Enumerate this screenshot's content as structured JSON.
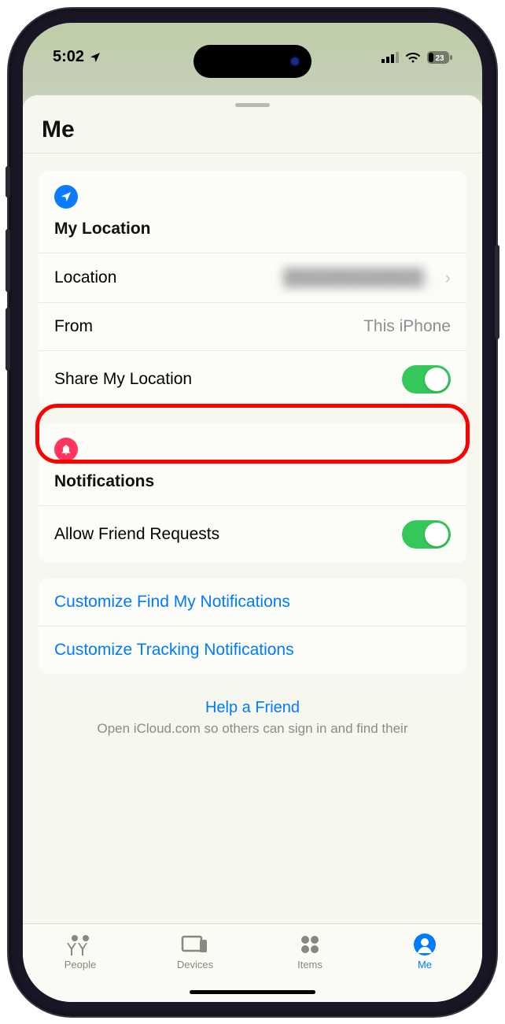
{
  "status": {
    "time": "5:02",
    "battery": "23"
  },
  "sheet": {
    "title": "Me"
  },
  "location": {
    "section_title": "My Location",
    "location_label": "Location",
    "location_value": "████████████…",
    "from_label": "From",
    "from_value": "This iPhone",
    "share_label": "Share My Location"
  },
  "notifications": {
    "section_title": "Notifications",
    "allow_label": "Allow Friend Requests"
  },
  "links": {
    "customize_findmy": "Customize Find My Notifications",
    "customize_tracking": "Customize Tracking Notifications"
  },
  "help": {
    "link": "Help a Friend",
    "sub": "Open iCloud.com so others can sign in and find their"
  },
  "tabs": {
    "people": "People",
    "devices": "Devices",
    "items": "Items",
    "me": "Me"
  }
}
